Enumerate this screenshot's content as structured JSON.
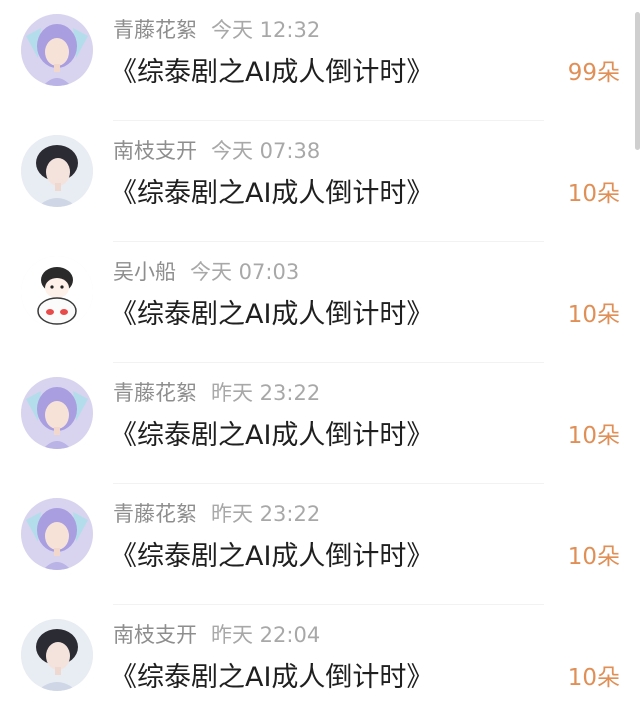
{
  "colors": {
    "username": "#8e8e8e",
    "time": "#a8a8a8",
    "title": "#1f1f1f",
    "gift_count": "#e08f56",
    "divider": "#f2f2f2"
  },
  "items": [
    {
      "avatar": "purple-hair-anime-avatar-icon",
      "username": "青藤花絮",
      "time": "今天 12:32",
      "title": "《综泰剧之AI成人倒计时》",
      "gift": "99朵"
    },
    {
      "avatar": "dark-hair-anime-boy-avatar-icon",
      "username": "南枝支开",
      "time": "今天 07:38",
      "title": "《综泰剧之AI成人倒计时》",
      "gift": "10朵"
    },
    {
      "avatar": "cartoon-girl-sticker-avatar-icon",
      "username": "吴小船",
      "time": "今天 07:03",
      "title": "《综泰剧之AI成人倒计时》",
      "gift": "10朵"
    },
    {
      "avatar": "purple-hair-anime-avatar-icon",
      "username": "青藤花絮",
      "time": "昨天 23:22",
      "title": "《综泰剧之AI成人倒计时》",
      "gift": "10朵"
    },
    {
      "avatar": "purple-hair-anime-avatar-icon",
      "username": "青藤花絮",
      "time": "昨天 23:22",
      "title": "《综泰剧之AI成人倒计时》",
      "gift": "10朵"
    },
    {
      "avatar": "dark-hair-anime-boy-avatar-icon",
      "username": "南枝支开",
      "time": "昨天 22:04",
      "title": "《综泰剧之AI成人倒计时》",
      "gift": "10朵"
    }
  ]
}
